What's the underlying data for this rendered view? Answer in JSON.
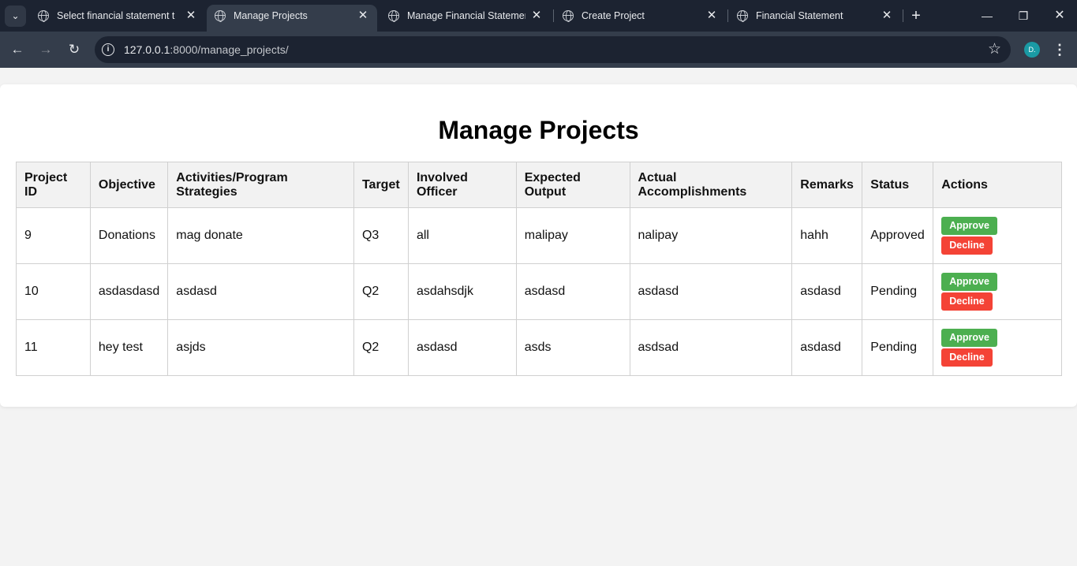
{
  "browser": {
    "tabs": [
      {
        "title": "Select financial statement to"
      },
      {
        "title": "Manage Projects"
      },
      {
        "title": "Manage Financial Statement"
      },
      {
        "title": "Create Project"
      },
      {
        "title": "Financial Statement"
      }
    ],
    "url_host": "127.0.0.1",
    "url_rest": ":8000/manage_projects/",
    "profile_initial": "D."
  },
  "page": {
    "title": "Manage Projects",
    "columns": [
      "Project ID",
      "Objective",
      "Activities/Program Strategies",
      "Target",
      "Involved Officer",
      "Expected Output",
      "Actual Accomplishments",
      "Remarks",
      "Status",
      "Actions"
    ],
    "rows": [
      {
        "id": "9",
        "objective": "Donations",
        "activities": "mag donate",
        "target": "Q3",
        "officer": "all",
        "expected": "malipay",
        "actual": "nalipay",
        "remarks": "hahh",
        "status": "Approved"
      },
      {
        "id": "10",
        "objective": "asdasdasd",
        "activities": "asdasd",
        "target": "Q2",
        "officer": "asdahsdjk",
        "expected": "asdasd",
        "actual": "asdasd",
        "remarks": "asdasd",
        "status": "Pending"
      },
      {
        "id": "11",
        "objective": "hey test",
        "activities": "asjds",
        "target": "Q2",
        "officer": "asdasd",
        "expected": "asds",
        "actual": "asdsad",
        "remarks": "asdasd",
        "status": "Pending"
      }
    ],
    "approve_label": "Approve",
    "decline_label": "Decline"
  },
  "colors": {
    "approve": "#4caf50",
    "decline": "#f44336",
    "chrome_dark": "#1c2331",
    "chrome_toolbar": "#343d4b"
  }
}
